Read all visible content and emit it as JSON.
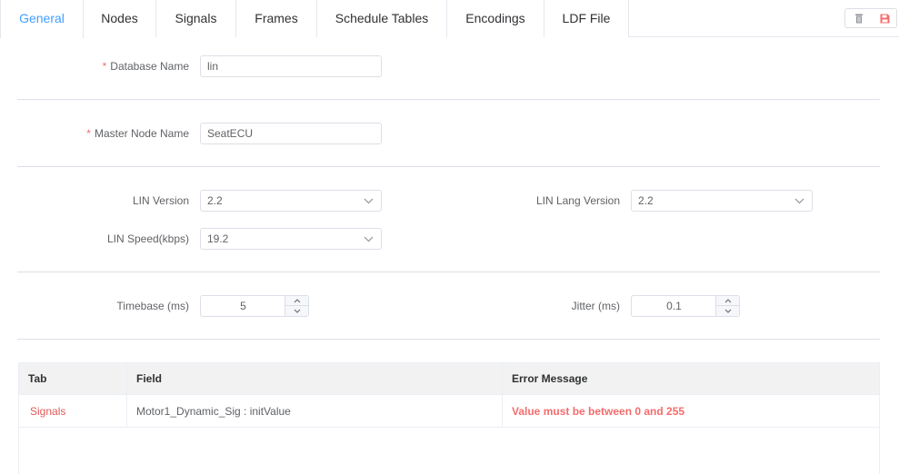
{
  "tabs": [
    {
      "label": "General",
      "active": true
    },
    {
      "label": "Nodes",
      "active": false
    },
    {
      "label": "Signals",
      "active": false
    },
    {
      "label": "Frames",
      "active": false
    },
    {
      "label": "Schedule Tables",
      "active": false
    },
    {
      "label": "Encodings",
      "active": false
    },
    {
      "label": "LDF File",
      "active": false
    }
  ],
  "toolbar": {
    "delete_icon": "trash-icon",
    "save_icon": "save-icon",
    "delete_color": "#909399",
    "save_color": "#f56c6c"
  },
  "form": {
    "required_mark": "*",
    "database_name": {
      "label": "Database Name",
      "value": "lin"
    },
    "master_node_name": {
      "label": "Master Node Name",
      "value": "SeatECU"
    },
    "lin_version": {
      "label": "LIN Version",
      "value": "2.2"
    },
    "lin_lang_version": {
      "label": "LIN Lang Version",
      "value": "2.2"
    },
    "lin_speed": {
      "label": "LIN Speed(kbps)",
      "value": "19.2"
    },
    "timebase": {
      "label": "Timebase (ms)",
      "value": "5"
    },
    "jitter": {
      "label": "Jitter (ms)",
      "value": "0.1"
    }
  },
  "error_table": {
    "headers": [
      "Tab",
      "Field",
      "Error Message"
    ],
    "rows": [
      {
        "tab": "Signals",
        "field": "Motor1_Dynamic_Sig : initValue",
        "message": "Value must be between 0 and 255"
      }
    ]
  },
  "colors": {
    "accent": "#409eff",
    "error": "#f56c6c",
    "link_red": "#e05a5a"
  }
}
